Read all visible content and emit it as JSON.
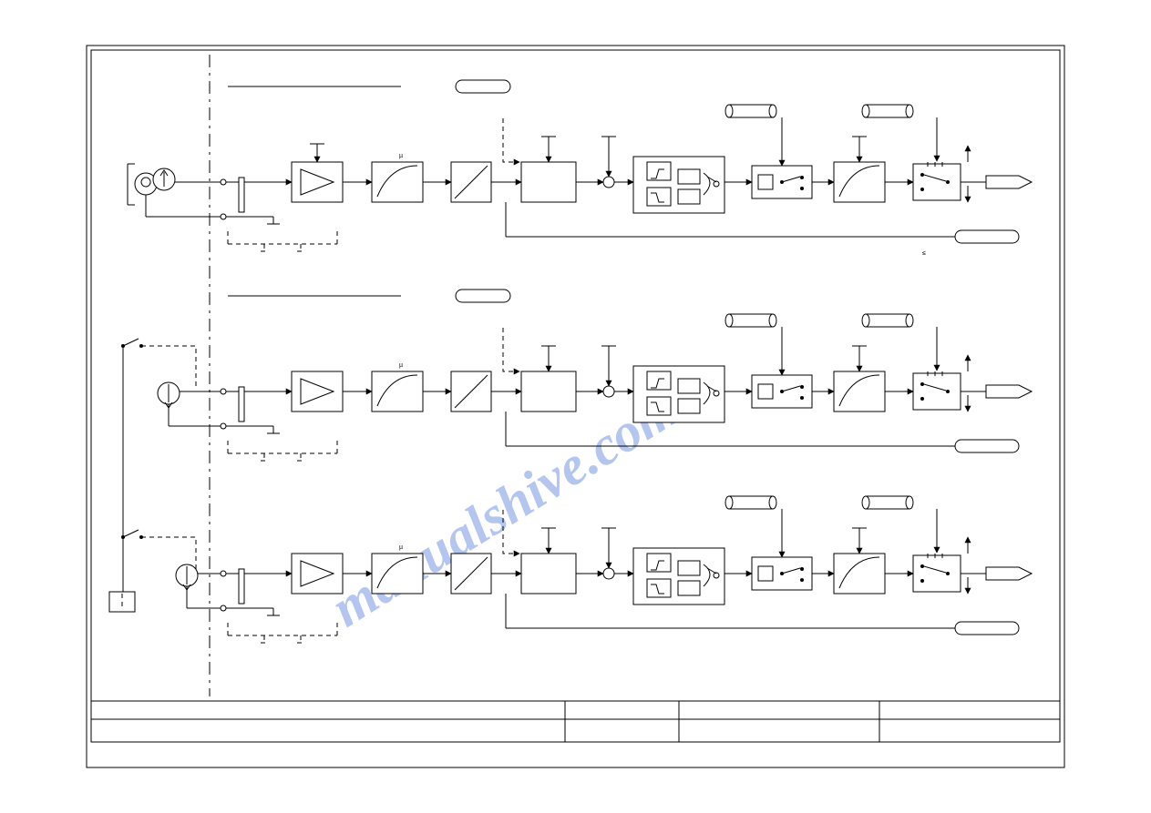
{
  "watermark": "manualshive.com",
  "frame": {
    "title": "",
    "sheet": "",
    "rev": ""
  },
  "channels": [
    {
      "id": 1,
      "section_label": "",
      "chip_label": "",
      "input_label": "",
      "amp": "",
      "filter1_note": "µ",
      "lin": "",
      "hold": "",
      "sum_pin": "",
      "comp_hi": "",
      "comp_lo": "",
      "switch": "",
      "latch": "",
      "filter2": "",
      "out_sw": "",
      "cyl_top": "",
      "cyl_out": "",
      "out_tag": "",
      "status_tag": "",
      "status_note": "≤"
    },
    {
      "id": 2,
      "section_label": "",
      "chip_label": "",
      "input_label": "",
      "amp": "",
      "filter1_note": "µ",
      "lin": "",
      "hold": "",
      "sum_pin": "",
      "comp_hi": "",
      "comp_lo": "",
      "switch": "",
      "latch": "",
      "filter2": "",
      "out_sw": "",
      "cyl_top": "",
      "cyl_out": "",
      "out_tag": "",
      "status_tag": "",
      "status_note": ""
    },
    {
      "id": 3,
      "section_label": "",
      "chip_label": "",
      "input_label": "",
      "amp": "",
      "filter1_note": "µ",
      "lin": "",
      "hold": "",
      "sum_pin": "",
      "comp_hi": "",
      "comp_lo": "",
      "switch": "",
      "latch": "",
      "filter2": "",
      "out_sw": "",
      "cyl_top": "",
      "cyl_out": "",
      "out_tag": "",
      "status_tag": "",
      "status_note": ""
    }
  ],
  "left_source": {
    "top_label": "",
    "jumper": "",
    "box": ""
  }
}
